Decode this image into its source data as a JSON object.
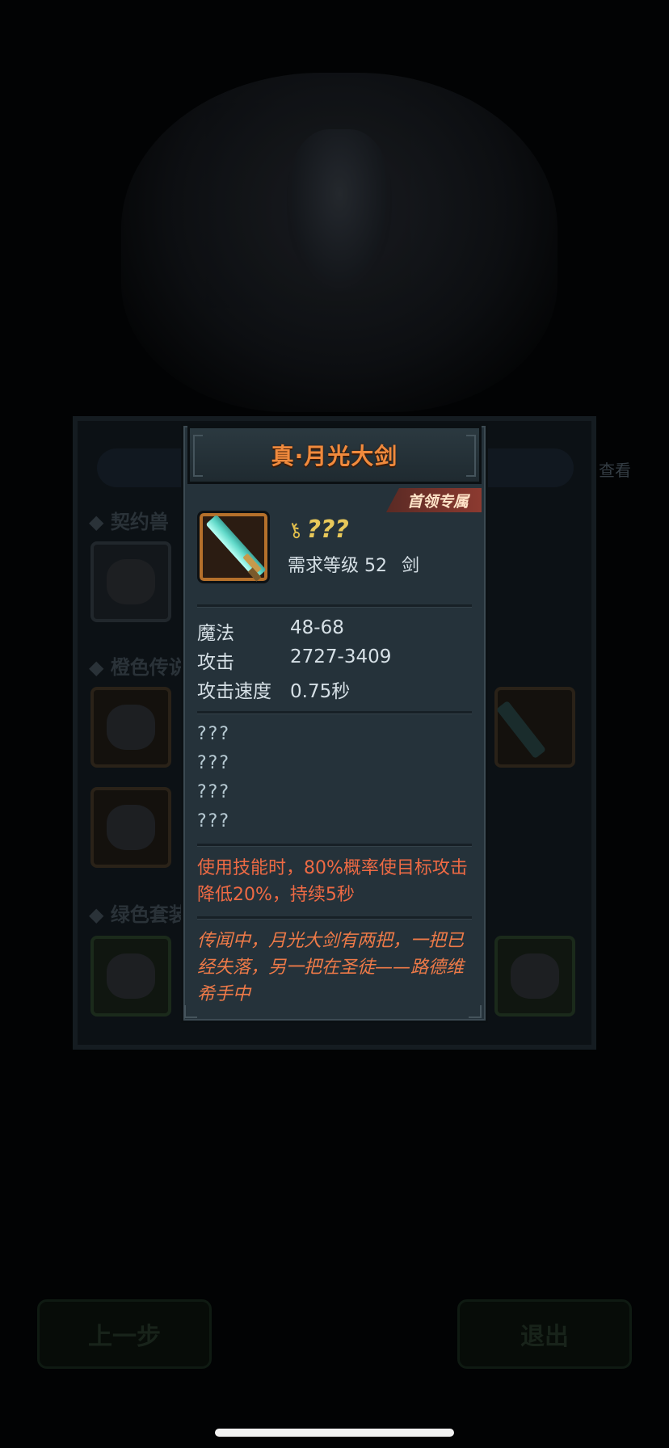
{
  "background": {
    "sections": {
      "contract": "◆ 契约兽",
      "orange": "◆ 橙色传说",
      "green": "◆ 绿色套装"
    },
    "side_label": "查看",
    "buttons": {
      "prev": "上一步",
      "exit": "退出"
    }
  },
  "item": {
    "name": "真·月光大剑",
    "tag": "首领专属",
    "unknown_name": "???",
    "requirement": {
      "level_label": "需求等级 52",
      "type": "剑"
    },
    "stats": [
      {
        "label": "魔法",
        "value": "48-68"
      },
      {
        "label": "攻击",
        "value": "2727-3409"
      },
      {
        "label": "攻击速度",
        "value": "0.75秒"
      }
    ],
    "unknown_attributes": [
      "???",
      "???",
      "???",
      "???"
    ],
    "effect": "使用技能时，80%概率使目标攻击降低20%，持续5秒",
    "lore": "传闻中，月光大剑有两把，一把已经失落，另一把在圣徒——路德维希手中"
  },
  "colors": {
    "title": "#f08a3d",
    "effect": "#ee6a44",
    "unknown": "#e8c85a",
    "tag": "#8c3a30"
  },
  "icons": {
    "item": "moonlight-greatsword-icon",
    "key": "key-icon"
  }
}
